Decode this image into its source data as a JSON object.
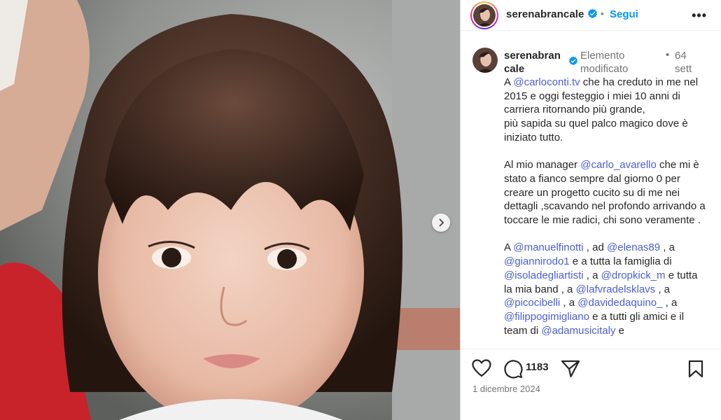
{
  "post": {
    "username": "serenabrancale",
    "username_line1": "serenabran",
    "username_line2": "cale",
    "follow_label": "Segui",
    "header_separator": "•",
    "more_label": "•••",
    "edited_label": "Elemento modificato",
    "caption_separator": "•",
    "time_label": "64 sett",
    "date": "1 dicembre 2024",
    "comment_count": "1183"
  },
  "caption": {
    "p1": {
      "t1": "A ",
      "m1": "@carloconti.tv",
      "t2": " che ha creduto in me nel 2015 e oggi festeggio i miei 10 anni di carriera ritornando più grande,",
      "t3": "più sapida su quel palco magico dove è iniziato tutto."
    },
    "p2": {
      "t1": "Al mio manager ",
      "m1": "@carlo_avarello",
      "t2": " che mi è stato a fianco sempre dal giorno 0 per creare un progetto cucito su di me nei dettagli ,scavando nel profondo arrivando a toccare le mie radici, chi sono veramente ."
    },
    "p3": {
      "t1": "A ",
      "m1": "@manuelfinotti",
      "t2": " , ad ",
      "m2": "@elenas89",
      "t3": " , a ",
      "m3": "@giannirodo1",
      "t4": " e a tutta la famiglia di ",
      "m4": "@isoladegliartisti",
      "t5": " , a ",
      "m5": "@dropkick_m",
      "t6": " e tutta la mia band , a ",
      "m6": "@lafvradelsklavs",
      "t7": " , a ",
      "m7": "@picocibelli",
      "t8": " , a ",
      "m8": "@davidedaquino_",
      "t9": " , a ",
      "m9": "@filippogimigliano",
      "t10": " e a tutti gli amici e il team di ",
      "m10": "@adamusicitaly",
      "t11": " e"
    }
  },
  "icons": {
    "verified": "verified-badge-icon",
    "more": "more-options-icon",
    "like": "heart-icon",
    "comment": "comment-icon",
    "share": "share-icon",
    "save": "bookmark-icon",
    "next": "chevron-right-icon"
  },
  "colors": {
    "accent": "#0095f6",
    "mention": "#4a5fd1",
    "muted": "#737373",
    "text": "#262626"
  }
}
